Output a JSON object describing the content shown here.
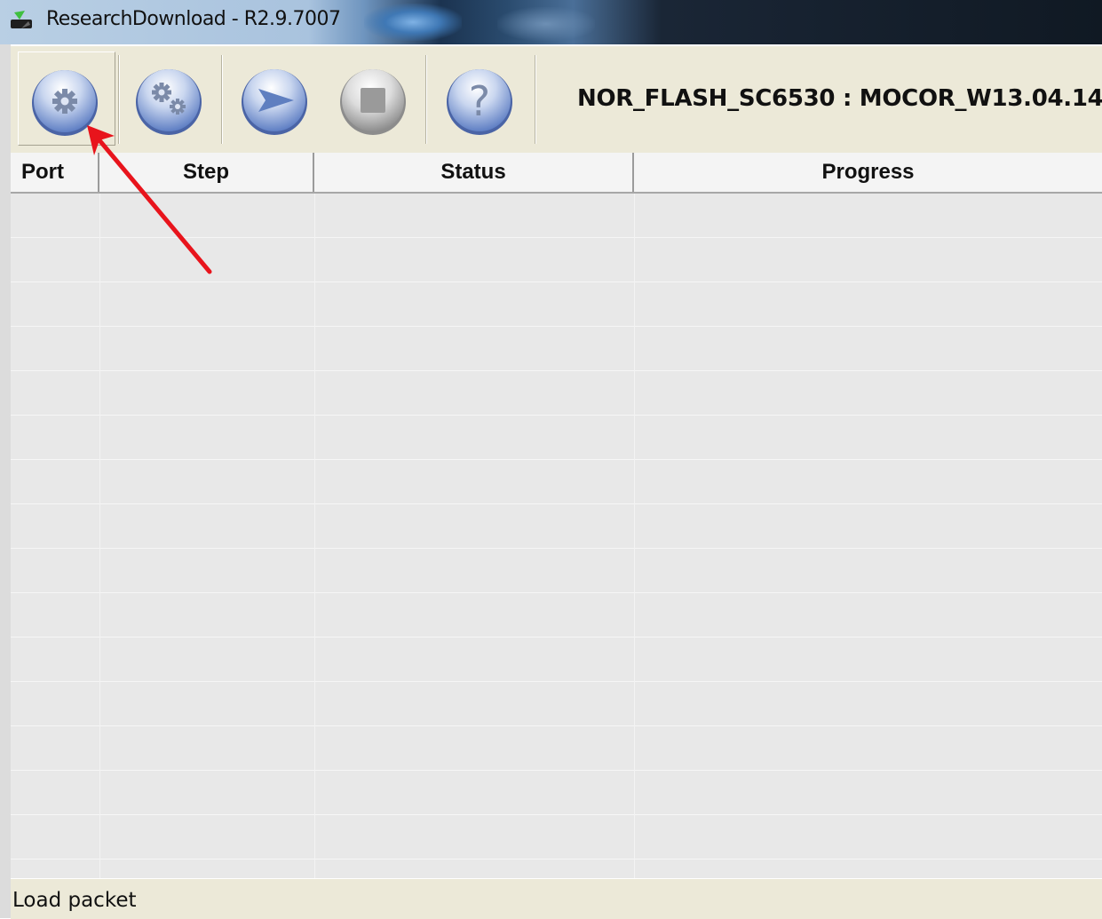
{
  "window": {
    "title": "ResearchDownload - R2.9.7007",
    "app_icon": "download-app-icon"
  },
  "toolbar": {
    "buttons": [
      {
        "name": "load-packet-button",
        "icon": "gear-icon"
      },
      {
        "name": "settings-button",
        "icon": "gears-icon"
      },
      {
        "name": "start-download-button",
        "icon": "play-arrow-icon"
      },
      {
        "name": "stop-download-button",
        "icon": "stop-square-icon"
      },
      {
        "name": "help-button",
        "icon": "question-mark-icon"
      }
    ],
    "firmware_label": "NOR_FLASH_SC6530 : MOCOR_W13.04.14"
  },
  "table": {
    "columns": [
      "Port",
      "Step",
      "Status",
      "Progress"
    ],
    "rows": []
  },
  "statusbar": {
    "text": "Load packet"
  },
  "annotation": {
    "arrow_color": "#e8141c"
  }
}
